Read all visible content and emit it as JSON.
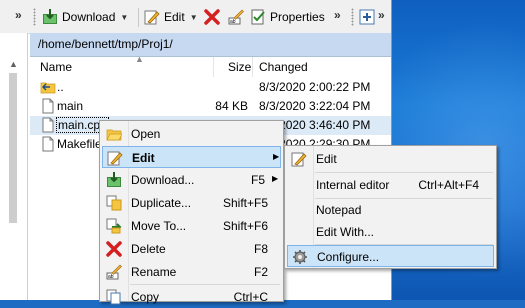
{
  "toolbar": {
    "download_label": "Download",
    "edit_label": "Edit",
    "properties_label": "Properties",
    "more_chevron": "»",
    "dropdown_arrow": "▼"
  },
  "path": "/home/bennett/tmp/Proj1/",
  "columns": {
    "name": "Name",
    "size": "Size",
    "changed": "Changed"
  },
  "files": [
    {
      "name": "..",
      "size": "",
      "changed": "8/3/2020 2:00:22 PM",
      "icon": "parent-folder-icon"
    },
    {
      "name": "main",
      "size": "84 KB",
      "changed": "8/3/2020 3:22:04 PM",
      "icon": "file-icon"
    },
    {
      "name": "main.cpp",
      "size": "",
      "changed": "8/3/2020 3:46:40 PM",
      "icon": "file-icon"
    },
    {
      "name": "Makefile",
      "size": "",
      "changed": "8/3/2020 2:29:30 PM",
      "icon": "file-icon"
    }
  ],
  "context_menu": {
    "items": [
      {
        "label": "Open",
        "shortcut": "",
        "icon": "open-icon"
      },
      {
        "label": "Edit",
        "shortcut": "",
        "icon": "edit-icon",
        "submenu": true
      },
      {
        "label": "Download...",
        "shortcut": "F5",
        "icon": "download-icon",
        "submenu": true
      },
      {
        "label": "Duplicate...",
        "shortcut": "Shift+F5",
        "icon": "duplicate-icon"
      },
      {
        "label": "Move To...",
        "shortcut": "Shift+F6",
        "icon": "move-icon"
      },
      {
        "label": "Delete",
        "shortcut": "F8",
        "icon": "delete-icon"
      },
      {
        "label": "Rename",
        "shortcut": "F2",
        "icon": "rename-icon"
      },
      {
        "label": "Copy",
        "shortcut": "Ctrl+C",
        "icon": "copy-icon"
      }
    ]
  },
  "edit_submenu": {
    "items": [
      {
        "label": "Edit",
        "shortcut": "",
        "icon": "edit-icon"
      },
      {
        "label": "Internal editor",
        "shortcut": "Ctrl+Alt+F4"
      },
      {
        "label": "Notepad",
        "shortcut": ""
      },
      {
        "label": "Edit With...",
        "shortcut": ""
      },
      {
        "label": "Configure...",
        "shortcut": "",
        "icon": "gear-icon"
      }
    ]
  },
  "colors": {
    "highlight": "#cce4f7",
    "path_bar": "#c6d9f1",
    "desktop": "#1a7bd6"
  }
}
